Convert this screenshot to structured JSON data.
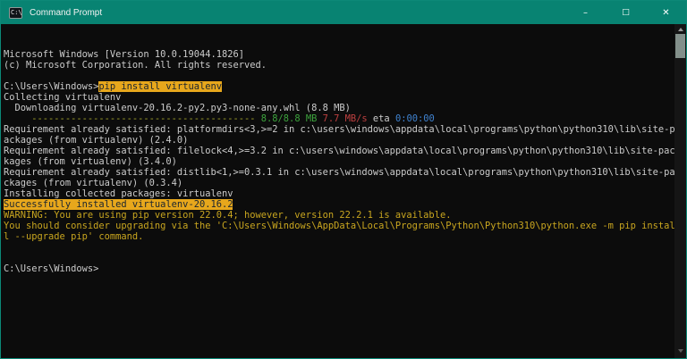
{
  "window": {
    "title": "Command Prompt",
    "icon_text": "C:\\",
    "controls": {
      "minimize": "–",
      "maximize": "□",
      "close": "✕"
    }
  },
  "colors": {
    "titlebar_teal": "#088372",
    "console_bg": "#0c0c0c",
    "default_text": "#cccccc",
    "highlight_bg": "#e7a71c",
    "warning_yellow": "#c9a61f",
    "progress_bar_olive": "#a3a42a",
    "download_size_green": "#3da33d",
    "speed_red": "#bf4040",
    "eta_blue": "#3f82cf"
  },
  "terminal": {
    "prompt": "C:\\Users\\Windows>",
    "lines": [
      [
        {
          "t": "Microsoft Windows [Version 10.0.19044.1826]",
          "c": "default"
        }
      ],
      [
        {
          "t": "(c) Microsoft Corporation. All rights reserved.",
          "c": "default"
        }
      ],
      [],
      [
        {
          "t": "C:\\Users\\Windows>",
          "c": "default"
        },
        {
          "t": "pip install virtualenv",
          "c": "hl"
        }
      ],
      [
        {
          "t": "Collecting virtualenv",
          "c": "default"
        }
      ],
      [
        {
          "t": "  Downloading virtualenv-20.16.2-py2.py3-none-any.whl (8.8 MB)",
          "c": "default"
        }
      ],
      [
        {
          "t": "     ",
          "c": "default"
        },
        {
          "t": "----------------------------------------",
          "c": "bar"
        },
        {
          "t": " ",
          "c": "default"
        },
        {
          "t": "8.8/8.8 MB",
          "c": "green"
        },
        {
          "t": " ",
          "c": "default"
        },
        {
          "t": "7.7 MB/s",
          "c": "red"
        },
        {
          "t": " eta ",
          "c": "default"
        },
        {
          "t": "0:00:00",
          "c": "blue"
        }
      ],
      [
        {
          "t": "Requirement already satisfied: platformdirs<3,>=2 in c:\\users\\windows\\appdata\\local\\programs\\python\\python310\\lib\\site-p",
          "c": "default"
        }
      ],
      [
        {
          "t": "ackages (from virtualenv) (2.4.0)",
          "c": "default"
        }
      ],
      [
        {
          "t": "Requirement already satisfied: filelock<4,>=3.2 in c:\\users\\windows\\appdata\\local\\programs\\python\\python310\\lib\\site-pac",
          "c": "default"
        }
      ],
      [
        {
          "t": "kages (from virtualenv) (3.4.0)",
          "c": "default"
        }
      ],
      [
        {
          "t": "Requirement already satisfied: distlib<1,>=0.3.1 in c:\\users\\windows\\appdata\\local\\programs\\python\\python310\\lib\\site-pa",
          "c": "default"
        }
      ],
      [
        {
          "t": "ckages (from virtualenv) (0.3.4)",
          "c": "default"
        }
      ],
      [
        {
          "t": "Installing collected packages: virtualenv",
          "c": "default"
        }
      ],
      [
        {
          "t": "Successfully installed virtualenv-20.16.2",
          "c": "hl"
        }
      ],
      [
        {
          "t": "WARNING: You are using pip version 22.0.4; however, version 22.2.1 is available.",
          "c": "yellow"
        }
      ],
      [
        {
          "t": "You should consider upgrading via the 'C:\\Users\\Windows\\AppData\\Local\\Programs\\Python\\Python310\\python.exe -m pip instal",
          "c": "yellow"
        }
      ],
      [
        {
          "t": "l --upgrade pip' command.",
          "c": "yellow"
        }
      ],
      [],
      [],
      [
        {
          "t": "C:\\Users\\Windows>",
          "c": "default"
        }
      ]
    ]
  }
}
